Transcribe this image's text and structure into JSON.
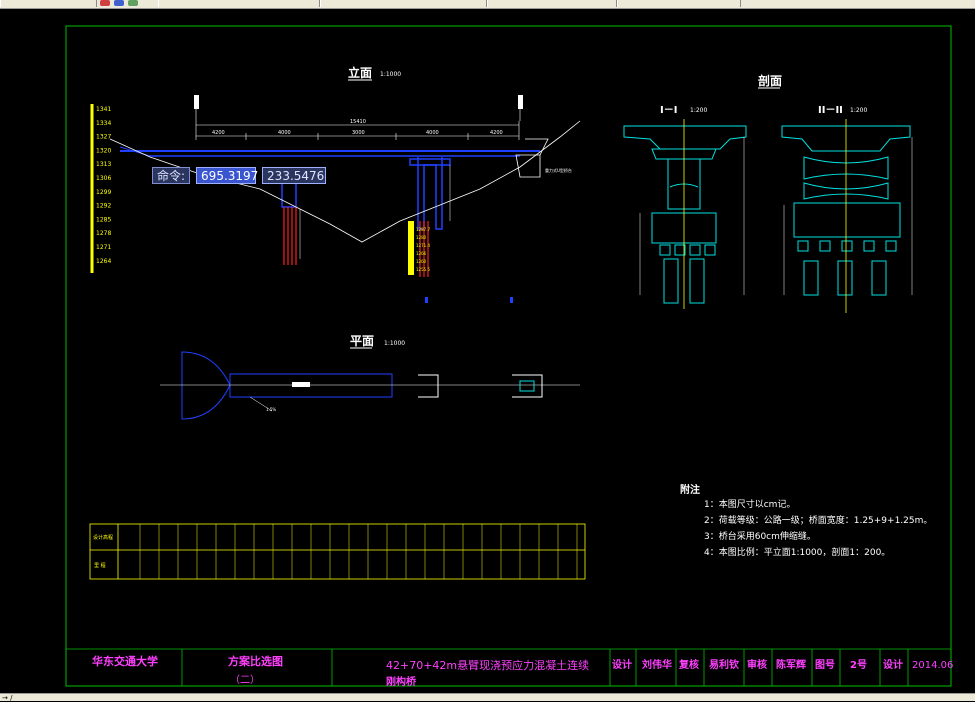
{
  "drawing": {
    "elevation_title": "立面",
    "elevation_scale": "1:1000",
    "section_title": "剖面",
    "section_1_label": "I－I",
    "section_1_scale": "1:200",
    "section_2_label": "II－II",
    "section_2_scale": "1:200",
    "plan_title": "平面",
    "plan_scale": "1:1000",
    "dim_total": "15410",
    "dims": [
      "4200",
      "4000",
      "3000",
      "4000",
      "4200"
    ],
    "elevation_ticks": [
      "1341",
      "1334",
      "1327",
      "1320",
      "1313",
      "1306",
      "1299",
      "1292",
      "1285",
      "1278",
      "1271",
      "1264"
    ],
    "notes": {
      "title": "附注",
      "items": [
        "1：本图尺寸以cm记。",
        "2：荷载等级：公路一级；桥面宽度：1.25+9+1.25m。",
        "3：桥台采用60cm伸缩缝。",
        "4：本图比例：平立面1:1000，剖面1：200。"
      ]
    }
  },
  "command_tip": {
    "label": "命令:",
    "value_x": "695.3197",
    "value_y": "233.5476"
  },
  "title_block": {
    "university": "华东交通大学",
    "drawing_name": "方案比选图",
    "drawing_sub": "（二）",
    "project": "42+70+42m悬臂现浇预应力混凝土连续",
    "project_line2": "刚构桥",
    "design_label": "设计",
    "designer": "刘伟华",
    "review_label": "复核",
    "reviewer": "易利钦",
    "approve_label": "审核",
    "approver": "陈军辉",
    "sheet_label": "图号",
    "sheet_no": "2号",
    "date_label": "设计",
    "date": "2014.06"
  },
  "table": {
    "row1_label": "设计高程",
    "row2_label": "里 程"
  },
  "colors": {
    "border": "#00c000",
    "structure": "#00e0e0",
    "deck": "#2040ff",
    "ground": "#ffffff",
    "axis": "#ffff00",
    "table": "#ffff00",
    "text": "#ffffff",
    "titleblock_text": "#ff40ff"
  },
  "status": {
    "text": "→ /"
  }
}
